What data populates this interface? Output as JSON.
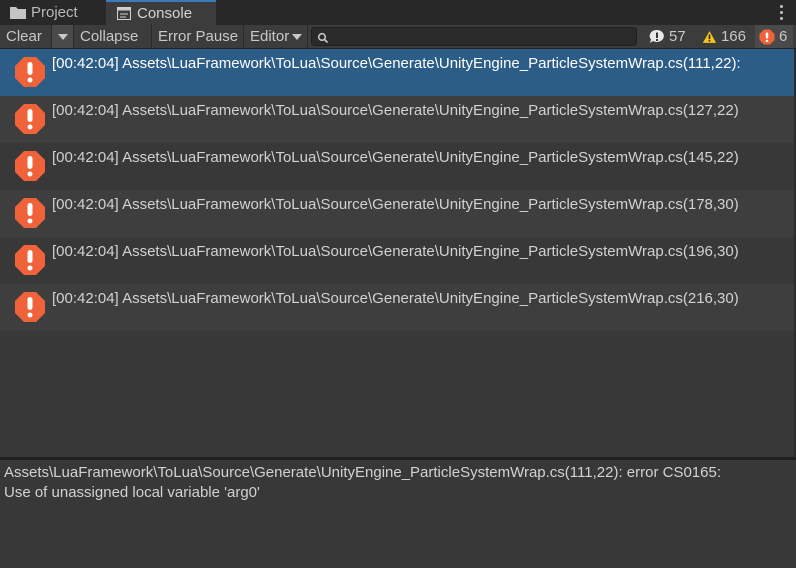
{
  "tabs": {
    "project": {
      "label": "Project",
      "icon": "folder-icon"
    },
    "console": {
      "label": "Console",
      "icon": "console-icon"
    }
  },
  "toolbar": {
    "clear": "Clear",
    "collapse": "Collapse",
    "error_pause": "Error Pause",
    "editor": "Editor",
    "search_value": "",
    "info_count": "57",
    "warning_count": "166",
    "error_count": "6"
  },
  "logs": [
    {
      "text": "[00:42:04] Assets\\LuaFramework\\ToLua\\Source\\Generate\\UnityEngine_ParticleSystemWrap.cs(111,22):"
    },
    {
      "text": "[00:42:04] Assets\\LuaFramework\\ToLua\\Source\\Generate\\UnityEngine_ParticleSystemWrap.cs(127,22)"
    },
    {
      "text": "[00:42:04] Assets\\LuaFramework\\ToLua\\Source\\Generate\\UnityEngine_ParticleSystemWrap.cs(145,22)"
    },
    {
      "text": "[00:42:04] Assets\\LuaFramework\\ToLua\\Source\\Generate\\UnityEngine_ParticleSystemWrap.cs(178,30)"
    },
    {
      "text": "[00:42:04] Assets\\LuaFramework\\ToLua\\Source\\Generate\\UnityEngine_ParticleSystemWrap.cs(196,30)"
    },
    {
      "text": "[00:42:04] Assets\\LuaFramework\\ToLua\\Source\\Generate\\UnityEngine_ParticleSystemWrap.cs(216,30)"
    }
  ],
  "detail": {
    "line1": "Assets\\LuaFramework\\ToLua\\Source\\Generate\\UnityEngine_ParticleSystemWrap.cs(111,22): error CS0165:",
    "line2": "Use of unassigned local variable 'arg0'"
  },
  "colors": {
    "error": "#f0623a",
    "warning": "#f5c518",
    "selected": "#2c5d87"
  }
}
